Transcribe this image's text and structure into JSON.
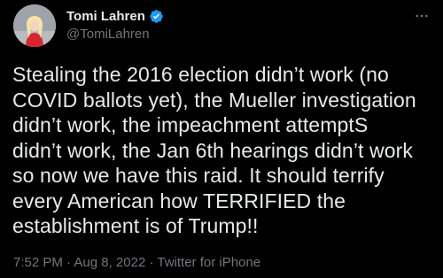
{
  "author": {
    "display_name": "Tomi Lahren",
    "handle": "@TomiLahren",
    "verified": true,
    "avatar_icon": "profile-photo"
  },
  "tweet": {
    "lines": [
      "Stealing the 2016 election didn’t work (no",
      "COVID ballots yet), the Mueller investigation",
      "didn’t work, the impeachment attemptS",
      "didn’t work, the Jan 6th hearings didn’t work",
      "so now we have this raid. It should terrify",
      "every American how TERRIFIED the",
      "establishment is of Trump!!"
    ]
  },
  "meta": {
    "time": "7:52 PM",
    "separator": " · ",
    "date": "Aug 8, 2022",
    "source": "Twitter for iPhone"
  },
  "colors": {
    "background": "#000000",
    "primary_text": "#e7e9ea",
    "secondary_text": "#71767b",
    "verified_badge": "#1d9bf0"
  },
  "icons": {
    "more": "more-horizontal-icon",
    "verified": "verified-badge-icon"
  }
}
